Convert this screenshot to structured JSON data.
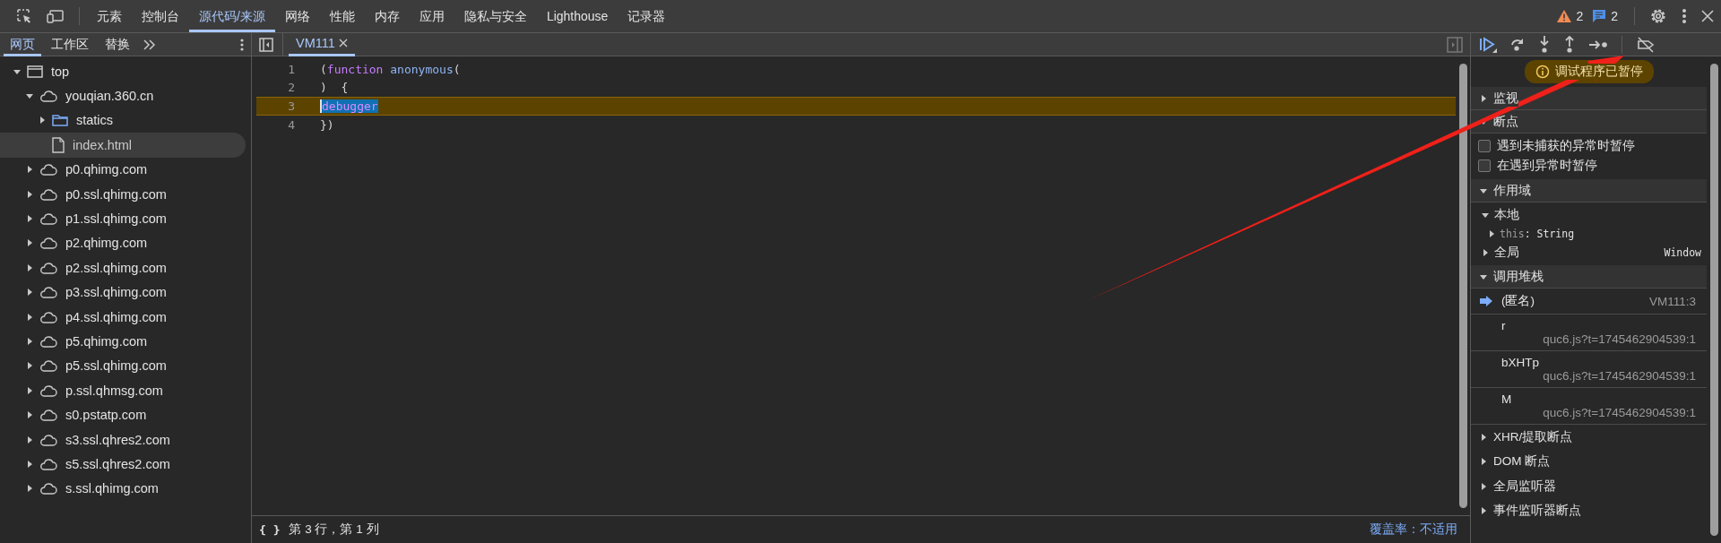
{
  "main_tabs": [
    {
      "label": "元素",
      "selected": false
    },
    {
      "label": "控制台",
      "selected": false
    },
    {
      "label": "源代码/来源",
      "selected": true
    },
    {
      "label": "网络",
      "selected": false
    },
    {
      "label": "性能",
      "selected": false
    },
    {
      "label": "内存",
      "selected": false
    },
    {
      "label": "应用",
      "selected": false
    },
    {
      "label": "隐私与安全",
      "selected": false
    },
    {
      "label": "Lighthouse",
      "selected": false
    },
    {
      "label": "记录器",
      "selected": false
    }
  ],
  "issues": {
    "warnings": "2",
    "messages": "2"
  },
  "sidebar": {
    "tabs": [
      {
        "label": "网页",
        "selected": true
      },
      {
        "label": "工作区",
        "selected": false
      },
      {
        "label": "替换",
        "selected": false
      }
    ],
    "tree": [
      {
        "label": "top",
        "kind": "frame",
        "expanded": true,
        "selected": false,
        "children": [
          {
            "label": "youqian.360.cn",
            "kind": "domain",
            "expanded": true,
            "selected": false,
            "children": [
              {
                "label": "statics",
                "kind": "folder",
                "expanded": false,
                "selected": false
              },
              {
                "label": "index.html",
                "kind": "file",
                "selected": true
              }
            ]
          },
          {
            "label": "p0.qhimg.com",
            "kind": "domain",
            "expanded": false,
            "selected": false
          },
          {
            "label": "p0.ssl.qhimg.com",
            "kind": "domain",
            "expanded": false,
            "selected": false
          },
          {
            "label": "p1.ssl.qhimg.com",
            "kind": "domain",
            "expanded": false,
            "selected": false
          },
          {
            "label": "p2.qhimg.com",
            "kind": "domain",
            "expanded": false,
            "selected": false
          },
          {
            "label": "p2.ssl.qhimg.com",
            "kind": "domain",
            "expanded": false,
            "selected": false
          },
          {
            "label": "p3.ssl.qhimg.com",
            "kind": "domain",
            "expanded": false,
            "selected": false
          },
          {
            "label": "p4.ssl.qhimg.com",
            "kind": "domain",
            "expanded": false,
            "selected": false
          },
          {
            "label": "p5.qhimg.com",
            "kind": "domain",
            "expanded": false,
            "selected": false
          },
          {
            "label": "p5.ssl.qhimg.com",
            "kind": "domain",
            "expanded": false,
            "selected": false
          },
          {
            "label": "p.ssl.qhmsg.com",
            "kind": "domain",
            "expanded": false,
            "selected": false
          },
          {
            "label": "s0.pstatp.com",
            "kind": "domain",
            "expanded": false,
            "selected": false
          },
          {
            "label": "s3.ssl.qhres2.com",
            "kind": "domain",
            "expanded": false,
            "selected": false
          },
          {
            "label": "s5.ssl.qhres2.com",
            "kind": "domain",
            "expanded": false,
            "selected": false
          },
          {
            "label": "s.ssl.qhimg.com",
            "kind": "domain",
            "expanded": false,
            "selected": false
          }
        ]
      }
    ]
  },
  "editor": {
    "tabs": [
      {
        "label": "VM111",
        "selected": true
      }
    ],
    "lines": [
      {
        "number": "1",
        "paused": false,
        "tokens": [
          {
            "kind": "punct",
            "text": "("
          },
          {
            "kind": "keyword",
            "text": "function"
          },
          {
            "kind": "name",
            "text": "anonymous"
          },
          {
            "kind": "punct",
            "text": "("
          }
        ]
      },
      {
        "number": "2",
        "paused": false,
        "tokens": [
          {
            "kind": "punct",
            "text": ")  {"
          }
        ]
      },
      {
        "number": "3",
        "paused": true,
        "tokens": [
          {
            "kind": "selected-keyword",
            "text": "debugger"
          }
        ]
      },
      {
        "number": "4",
        "paused": false,
        "tokens": [
          {
            "kind": "punct",
            "text": "})"
          }
        ]
      }
    ],
    "status": {
      "format": "{ }",
      "position": "第 3 行，第 1 列",
      "coverage": "覆盖率：不适用"
    }
  },
  "debugger": {
    "banner": "调试程序已暂停",
    "watch": {
      "title": "监视",
      "expanded": false
    },
    "breakpoints": {
      "title": "断点",
      "expanded": true,
      "options": [
        {
          "label": "遇到未捕获的异常时暂停",
          "checked": false
        },
        {
          "label": "在遇到异常时暂停",
          "checked": false
        }
      ]
    },
    "scope": {
      "title": "作用域",
      "expanded": true,
      "items": [
        {
          "label": "本地",
          "expanded": true,
          "children": [
            {
              "name": "this",
              "value": ": String",
              "expanded": false
            }
          ]
        },
        {
          "label": "全局",
          "expanded": false,
          "value": "Window"
        }
      ]
    },
    "call_stack": {
      "title": "调用堆栈",
      "expanded": true,
      "frames": [
        {
          "name": "(匿名)",
          "location": "VM111:3",
          "selected": true
        },
        {
          "name": "r",
          "location": "quc6.js?t=1745462904539:1",
          "selected": false
        },
        {
          "name": "bXHTp",
          "location": "quc6.js?t=1745462904539:1",
          "selected": false
        },
        {
          "name": "M",
          "location": "quc6.js?t=1745462904539:1",
          "selected": false
        }
      ]
    },
    "more_panes": [
      {
        "title": "XHR/提取断点",
        "expanded": false
      },
      {
        "title": "DOM 断点",
        "expanded": false
      },
      {
        "title": "全局监听器",
        "expanded": false
      },
      {
        "title": "事件监听器断点",
        "expanded": false
      }
    ]
  }
}
